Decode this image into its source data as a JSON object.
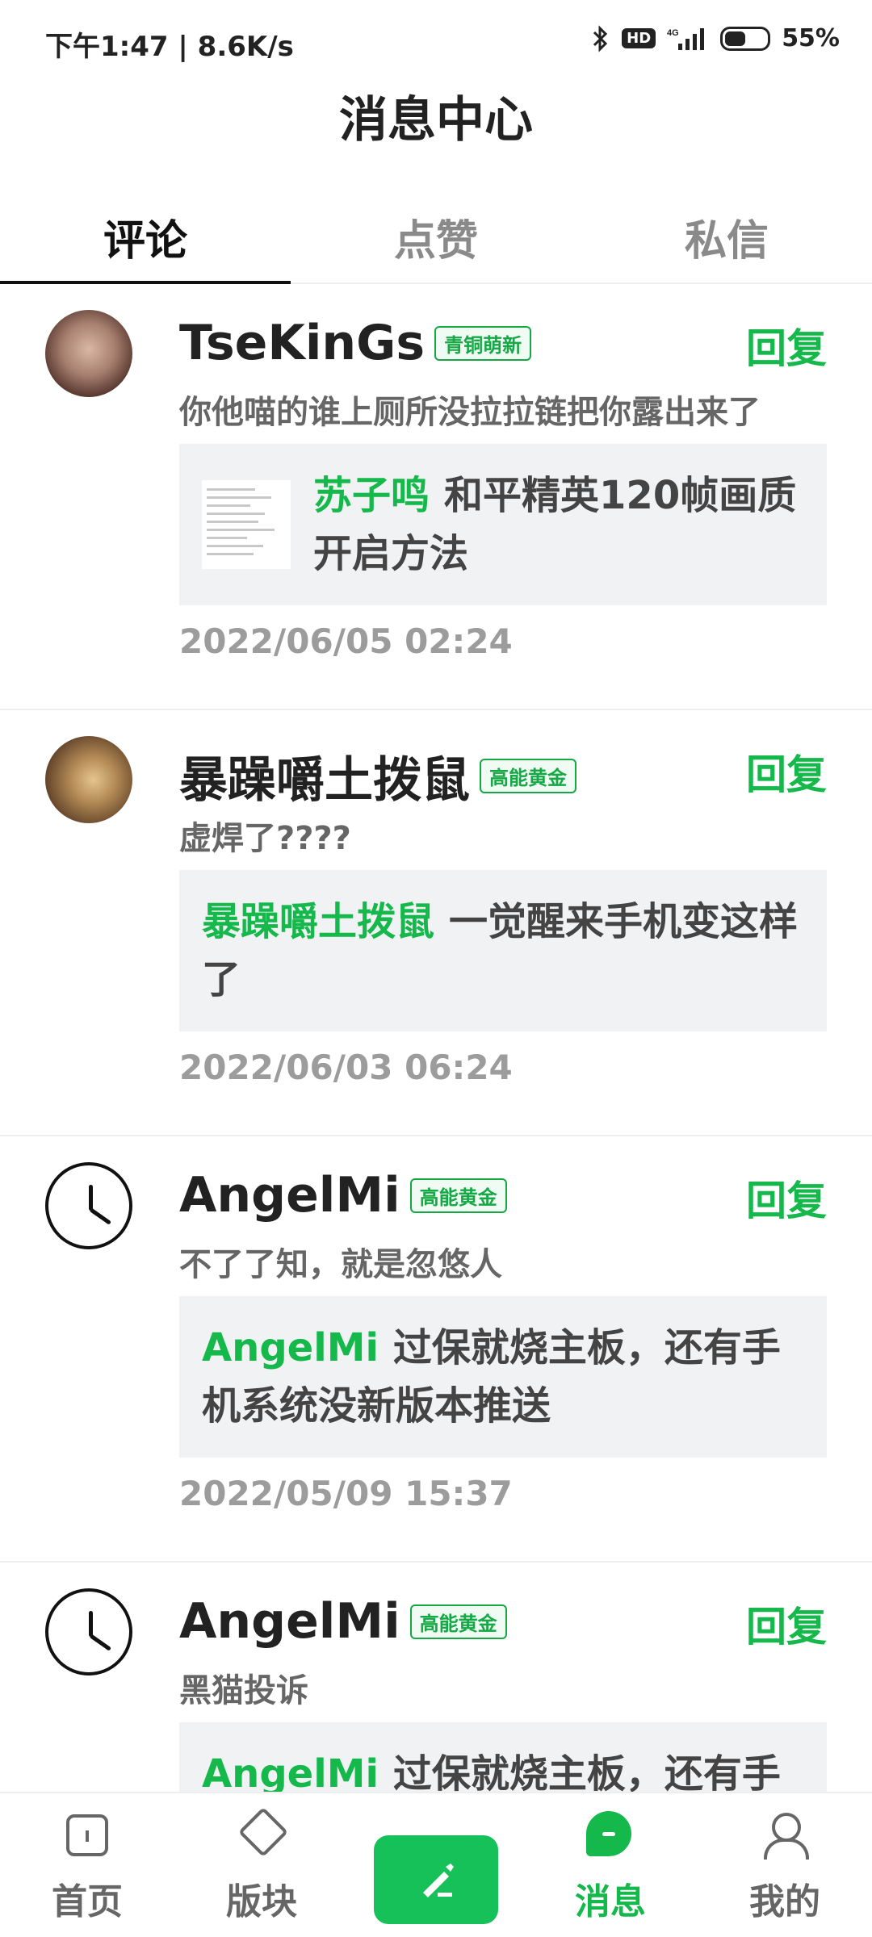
{
  "status_bar": {
    "time_speed": "下午1:47 | 8.6K/s",
    "bluetooth_icon": "bluetooth-icon",
    "hd_label": "HD",
    "signal_label": "4G",
    "battery_percent": "55%"
  },
  "header": {
    "title": "消息中心"
  },
  "tabs": [
    {
      "label": "评论",
      "active": true
    },
    {
      "label": "点赞",
      "active": false
    },
    {
      "label": "私信",
      "active": false
    }
  ],
  "items": [
    {
      "username": "TseKinGs",
      "badge": "青铜萌新",
      "reply": "回复",
      "comment": "你他喵的谁上厕所没拉拉链把你露出来了",
      "quote_author": "苏子鸣",
      "quote_text": "和平精英120帧画质开启方法",
      "time": "2022/06/05 02:24"
    },
    {
      "username": "暴躁嚼土拨鼠",
      "badge": "高能黄金",
      "reply": "回复",
      "comment": "虚焊了????",
      "quote_author": "暴躁嚼土拨鼠",
      "quote_text": "一觉醒来手机变这样了",
      "time": "2022/06/03 06:24"
    },
    {
      "username": "AngelMi",
      "badge": "高能黄金",
      "reply": "回复",
      "comment": "不了了知，就是忽悠人",
      "quote_author": "AngelMi",
      "quote_text": "过保就烧主板，还有手机系统没新版本推送",
      "time": "2022/05/09 15:37"
    },
    {
      "username": "AngelMi",
      "badge": "高能黄金",
      "reply": "回复",
      "comment": "黑猫投诉",
      "quote_author": "AngelMi",
      "quote_text": "过保就烧主板，还有手机系统没新版本推送",
      "time": ""
    }
  ],
  "bottom_nav": {
    "home": "首页",
    "boards": "版块",
    "compose_icon": "pen-icon",
    "messages": "消息",
    "mine": "我的"
  },
  "colors": {
    "accent": "#15b84a",
    "compose": "#16c15a",
    "quote_bg": "#f1f2f4"
  }
}
